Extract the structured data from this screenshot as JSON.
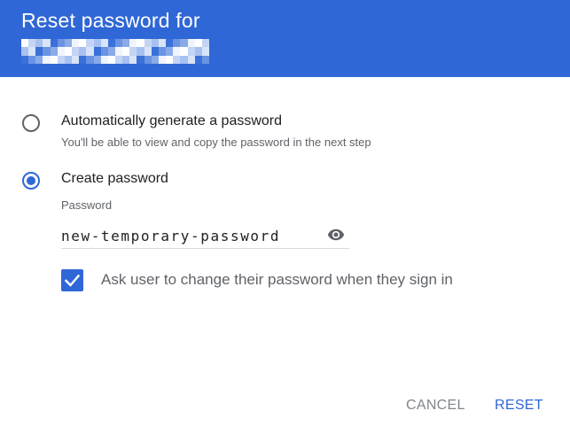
{
  "dialog": {
    "title": "Reset password for",
    "accent_color": "#2f67d6"
  },
  "options": [
    {
      "label": "Automatically generate a password",
      "sub": "You'll be able to view and copy the password in the next step",
      "selected": false
    },
    {
      "label": "Create password",
      "selected": true
    }
  ],
  "password": {
    "label": "Password",
    "value": "new-temporary-password",
    "icon": "eye-icon"
  },
  "change_on_signin": {
    "label": "Ask user to change their password when they sign in",
    "checked": true
  },
  "actions": {
    "cancel": "CANCEL",
    "reset": "RESET"
  }
}
